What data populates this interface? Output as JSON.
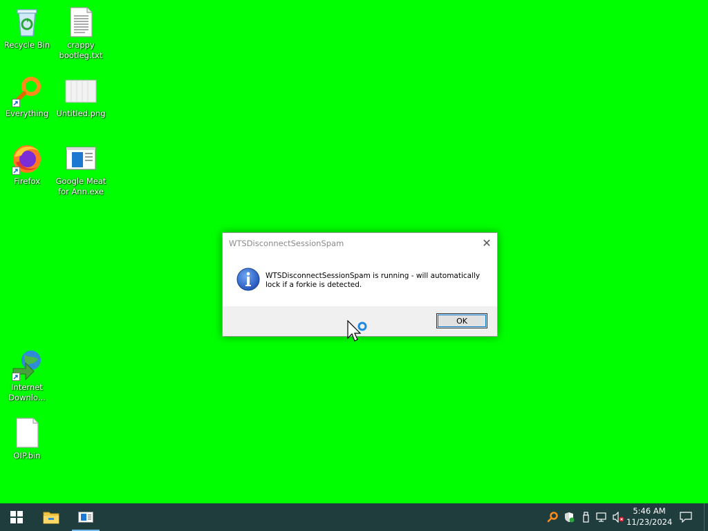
{
  "desktop": {
    "background_color": "#00ff00",
    "icons": [
      {
        "label": "Recycle Bin",
        "icon": "recycle-bin-icon"
      },
      {
        "label": "crappy bootleg.txt",
        "icon": "text-file-icon"
      },
      {
        "label": "Everything",
        "icon": "everything-search-icon"
      },
      {
        "label": "Untitled.png",
        "icon": "image-file-icon"
      },
      {
        "label": "Firefox",
        "icon": "firefox-icon"
      },
      {
        "label": "Google Meat for Ann.exe",
        "icon": "exe-window-icon"
      },
      {
        "label": "Internet Downlo...",
        "icon": "internet-download-manager-icon"
      },
      {
        "label": "OIP.bin",
        "icon": "blank-file-icon"
      }
    ]
  },
  "dialog": {
    "title": "WTSDisconnectSessionSpam",
    "close_glyph": "✕",
    "message": "WTSDisconnectSessionSpam is running - will automatically lock if a forkie is detected.",
    "ok_label": "OK",
    "icon": "info-icon"
  },
  "taskbar": {
    "color": "#1f3d3d",
    "start_icon": "windows-start-icon",
    "pinned": [
      {
        "icon": "file-explorer-icon",
        "active": false
      },
      {
        "icon": "app-window-icon",
        "active": true
      }
    ],
    "tray_icons": [
      "everything-tray-icon",
      "defender-shield-icon",
      "usb-drive-icon",
      "network-icon",
      "volume-muted-icon"
    ],
    "time": "5:46 AM",
    "date": "11/23/2024",
    "notifications_icon": "action-center-icon"
  }
}
